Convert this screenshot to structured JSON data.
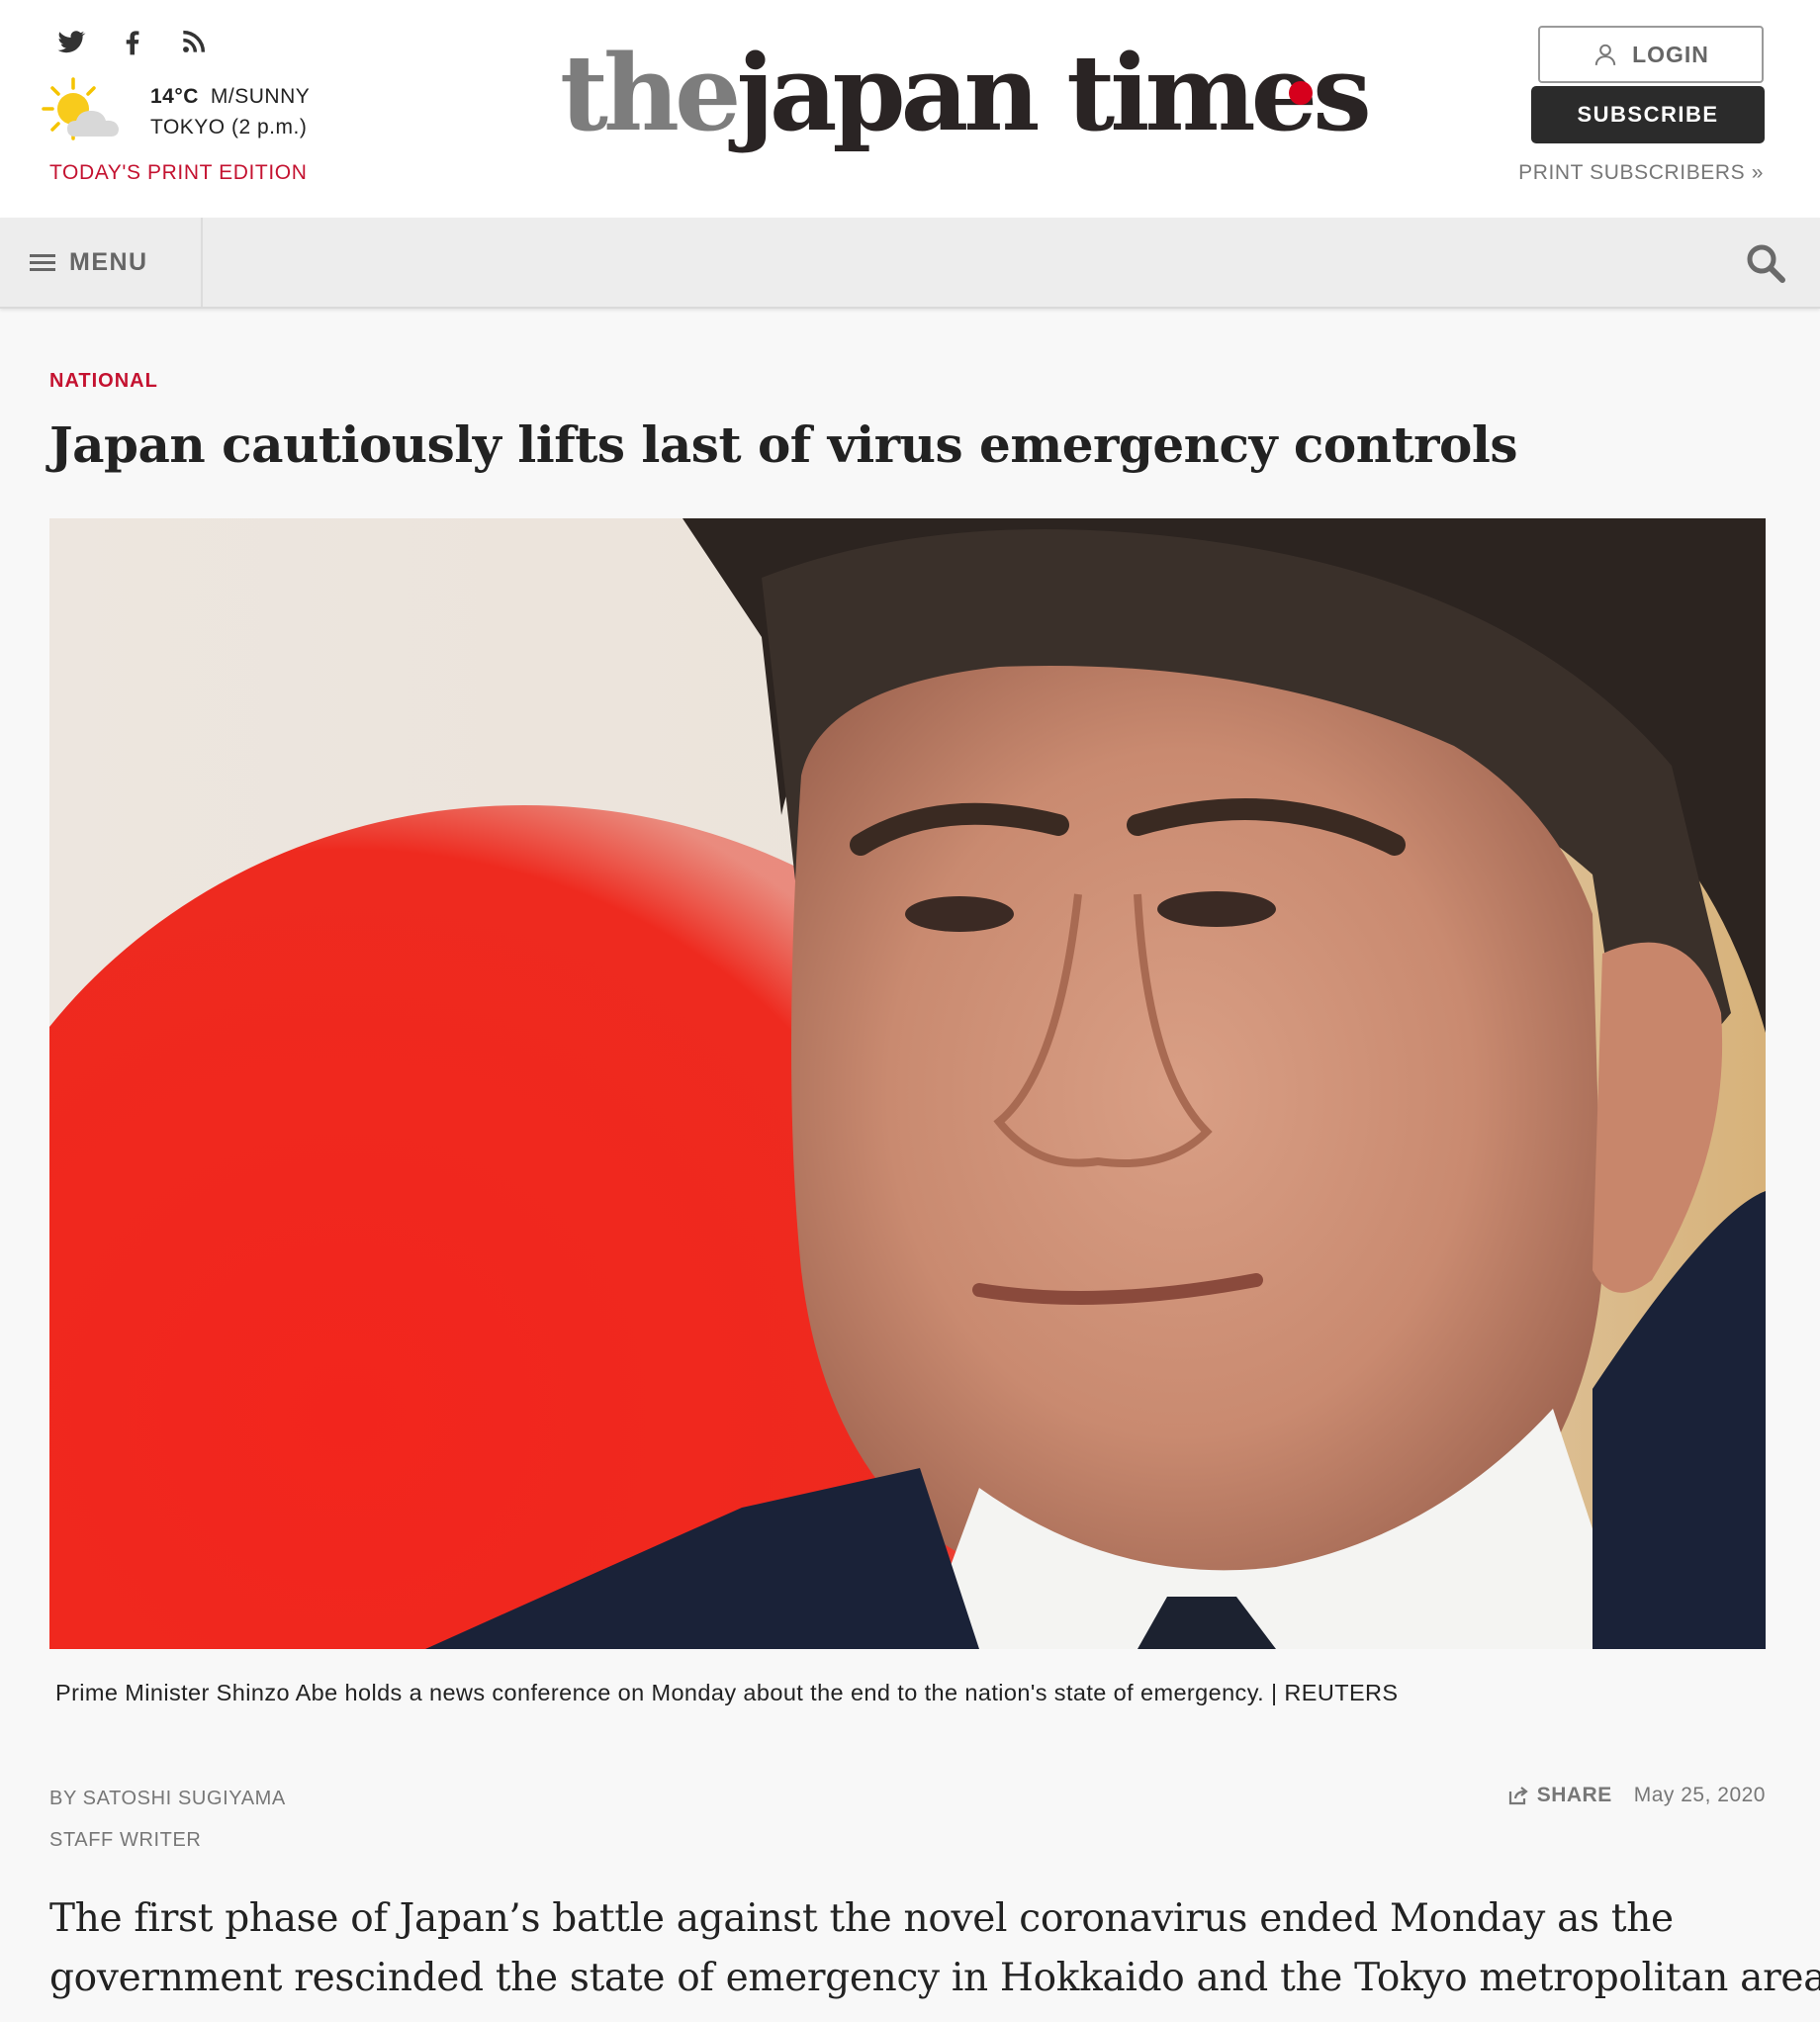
{
  "header": {
    "social": {
      "twitter_icon": "twitter-icon",
      "facebook_icon": "facebook-icon",
      "rss_icon": "rss-icon"
    },
    "weather": {
      "icon": "partly-sunny-icon",
      "temp": "14°C",
      "condition": "M/SUNNY",
      "location": "TOKYO (2 p.m.)"
    },
    "print_edition": "TODAY'S PRINT EDITION",
    "logo": {
      "the": "the",
      "rest": "japan times"
    },
    "login_label": "LOGIN",
    "subscribe_label": "SUBSCRIBE",
    "print_subscribers": "PRINT SUBSCRIBERS »"
  },
  "nav": {
    "menu_label": "MENU",
    "search_icon": "search-icon"
  },
  "article": {
    "category": "NATIONAL",
    "headline": "Japan cautiously lifts last of virus emergency controls",
    "photo_caption": "Prime Minister Shinzo Abe holds a news conference on Monday about the end to the nation's state of emergency. | REUTERS",
    "byline": "BY SATOSHI SUGIYAMA",
    "role": "STAFF WRITER",
    "share_label": "SHARE",
    "date": "May 25, 2020",
    "lede_line1": "The first phase of Japan’s battle against the novel coronavirus ended Monday as the",
    "lede_line2": "government rescinded the state of emergency in Hokkaido and the Tokyo metropolitan area,"
  },
  "colors": {
    "accent_red": "#c41230",
    "logo_dot": "#d6001c",
    "subscribe_bg": "#2b2b2b",
    "nav_bg": "#ededed"
  }
}
